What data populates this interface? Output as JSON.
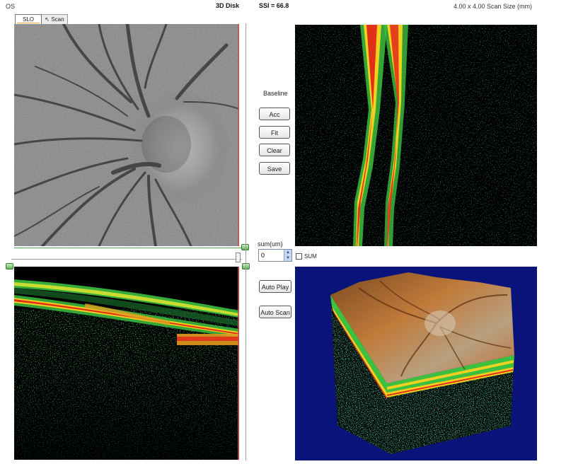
{
  "header": {
    "eye": "OS",
    "scan_type": "3D Disk",
    "ssi": "SSI = 66.8",
    "scan_size": "4.00 x 4.00 Scan Size (mm)"
  },
  "tabs": [
    {
      "label": "SLO",
      "active": true
    },
    {
      "label": "↖ Scan",
      "active": false
    }
  ],
  "controls": {
    "baseline_label": "Baseline",
    "buttons": [
      "Acc",
      "Fit",
      "Clear",
      "Save"
    ],
    "sum_label": "sum(um)",
    "sum_value": "0",
    "sum_checkbox_label": "SUM",
    "sum_checked": false,
    "autoplay_label": "Auto Play",
    "autoscan_label": "Auto Scan"
  },
  "colors": {
    "volume_background": "#0a137a",
    "scan_background": "#000000",
    "oct_yellow": "#f0e030",
    "oct_red": "#e23018",
    "oct_green": "#40c040"
  },
  "icons": {
    "spin_up": "chevron-up-icon",
    "spin_down": "chevron-down-icon",
    "slider_handle": "slider-handle-icon"
  }
}
